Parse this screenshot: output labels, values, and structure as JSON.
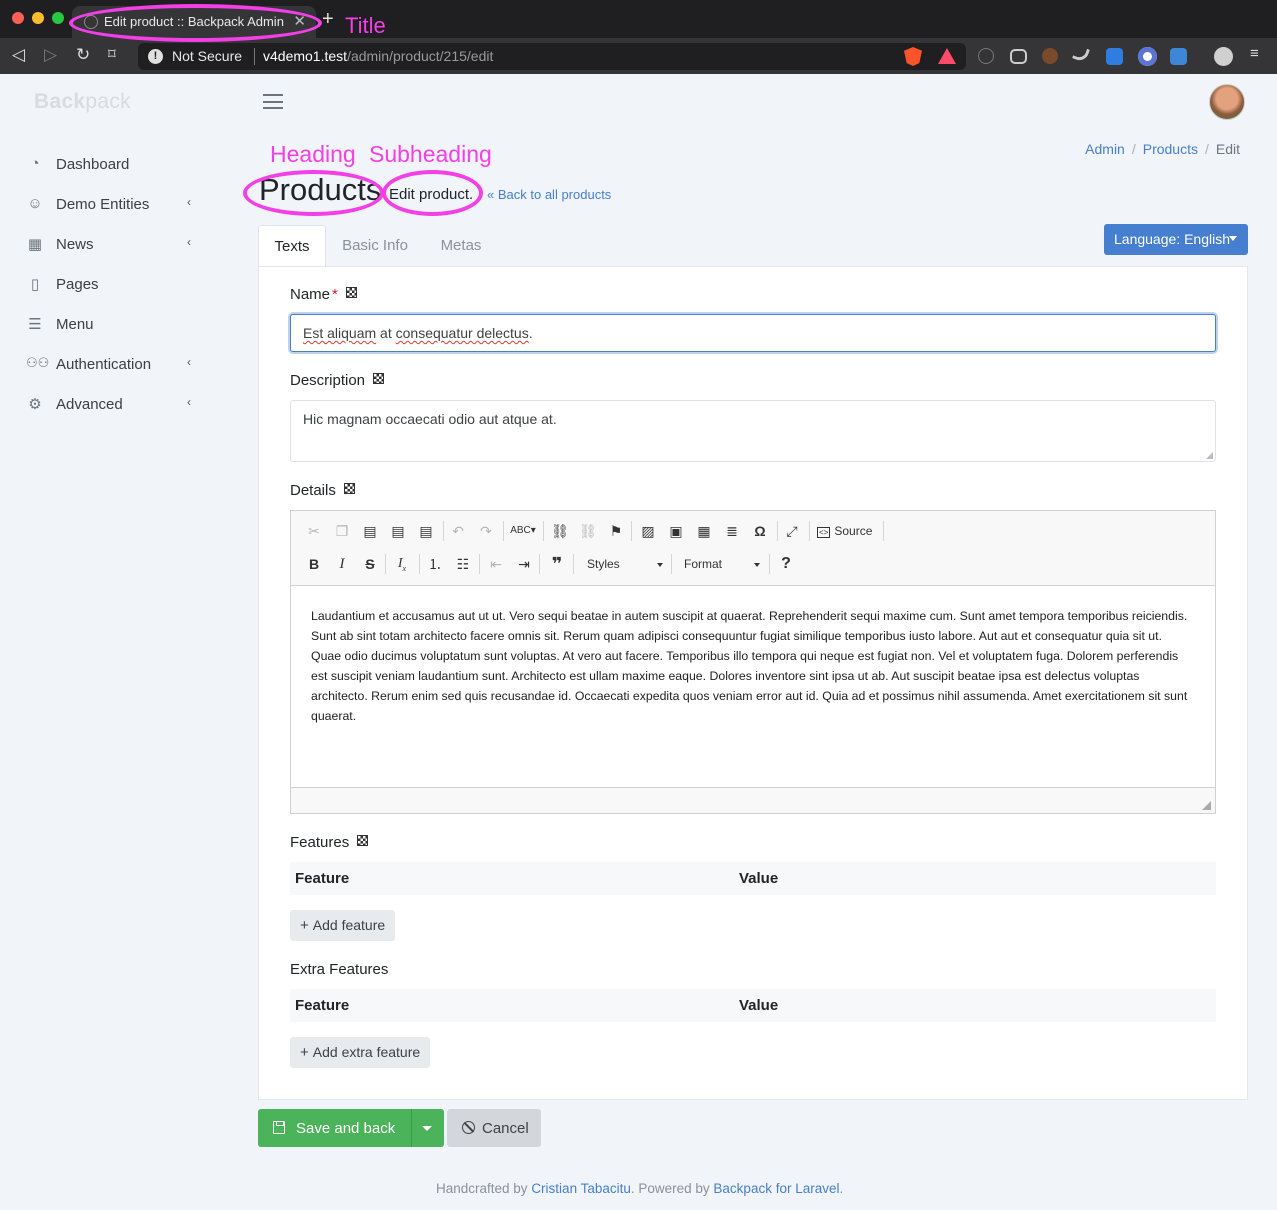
{
  "browser": {
    "tab_title": "Edit product :: Backpack Admin",
    "close_glyph": "✕",
    "new_tab_glyph": "+",
    "security_label": "Not Secure",
    "url_host": "v4demo1.test",
    "url_path": "/admin/product/215/edit"
  },
  "annotations": {
    "title": "Title",
    "heading": "Heading",
    "subheading": "Subheading",
    "color": "#f23fe6"
  },
  "app": {
    "logo_bold": "Back",
    "logo_rest": "pack"
  },
  "sidebar": {
    "items": [
      {
        "label": "Dashboard",
        "icon": "gauge-icon",
        "has_children": false
      },
      {
        "label": "Demo Entities",
        "icon": "smile-icon",
        "has_children": true
      },
      {
        "label": "News",
        "icon": "newspaper-icon",
        "has_children": true
      },
      {
        "label": "Pages",
        "icon": "file-icon",
        "has_children": false
      },
      {
        "label": "Menu",
        "icon": "list-icon",
        "has_children": false
      },
      {
        "label": "Authentication",
        "icon": "users-icon",
        "has_children": true
      },
      {
        "label": "Advanced",
        "icon": "cogs-icon",
        "has_children": true
      }
    ]
  },
  "breadcrumb": {
    "items": [
      "Admin",
      "Products",
      "Edit"
    ],
    "separator": "/"
  },
  "header": {
    "title": "Products",
    "subtitle": "Edit product.",
    "back_link": "Back to all products"
  },
  "tabs": [
    "Texts",
    "Basic Info",
    "Metas"
  ],
  "active_tab": "Texts",
  "language_button": "Language: English",
  "form": {
    "name": {
      "label": "Name",
      "required_mark": "*",
      "value_parts": [
        "Est aliquam",
        " at ",
        "consequatur delectus",
        "."
      ]
    },
    "description": {
      "label": "Description",
      "value": "Hic magnam occaecati odio aut atque at."
    },
    "details": {
      "label": "Details",
      "source_label": "Source",
      "styles_label": "Styles",
      "format_label": "Format",
      "body": "Laudantium et accusamus aut ut ut. Vero sequi beatae in autem suscipit at quaerat. Reprehenderit sequi maxime cum. Sunt amet tempora temporibus reiciendis. Sunt ab sint totam architecto facere omnis sit. Rerum quam adipisci consequuntur fugiat similique temporibus iusto labore. Aut aut et consequatur quia sit ut. Quae odio ducimus voluptatum sunt voluptas. At vero aut facere. Temporibus illo tempora qui neque est fugiat non. Vel et voluptatem fuga. Dolorem perferendis est suscipit veniam laudantium sunt. Architecto est ullam maxime eaque. Dolores inventore sint ipsa ut ab. Aut suscipit beatae ipsa est delectus voluptas architecto. Rerum enim sed quis recusandae id. Occaecati expedita quos veniam error aut id. Quia ad et possimus nihil assumenda. Amet exercitationem sit sunt quaerat."
    },
    "features": {
      "label": "Features",
      "col_feature": "Feature",
      "col_value": "Value",
      "add_label": "Add feature"
    },
    "extra_features": {
      "label": "Extra Features",
      "col_feature": "Feature",
      "col_value": "Value",
      "add_label": "Add extra feature"
    }
  },
  "actions": {
    "save_label": "Save and back",
    "cancel_label": "Cancel"
  },
  "footer": {
    "prefix": "Handcrafted by ",
    "author": "Cristian Tabacitu",
    "middle": ". Powered by ",
    "product": "Backpack for Laravel",
    "suffix": "."
  },
  "colors": {
    "primary": "#467fcf",
    "success": "#4bb35a",
    "secondary": "#d3d7db"
  }
}
